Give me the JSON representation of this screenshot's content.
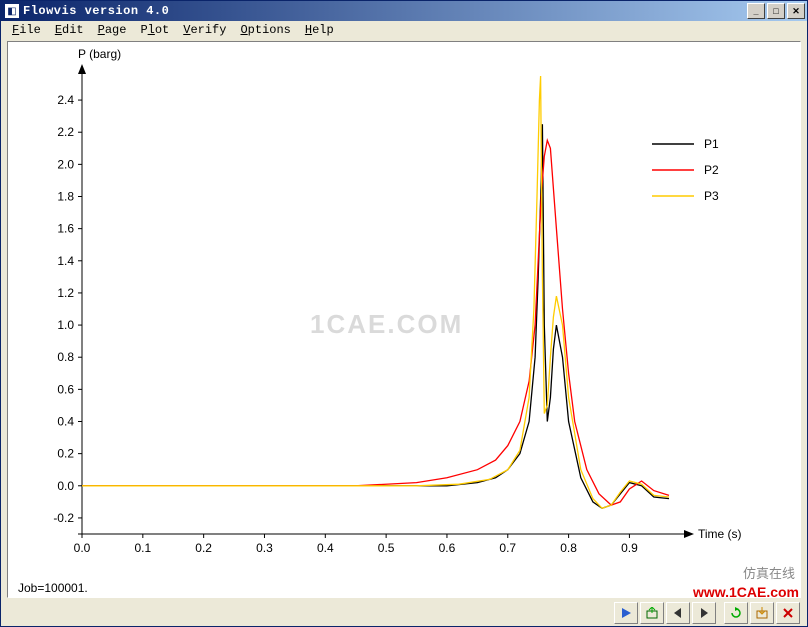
{
  "window": {
    "title": "Flowvis version 4.0"
  },
  "menu": {
    "file": "File",
    "edit": "Edit",
    "page": "Page",
    "plot": "Plot",
    "verify": "Verify",
    "options": "Options",
    "help": "Help"
  },
  "job_label": "Job=100001.",
  "legend": {
    "s1": "P1",
    "s2": "P2",
    "s3": "P3"
  },
  "colors": {
    "p1": "#000000",
    "p2": "#ff0000",
    "p3": "#ffcc00"
  },
  "watermarks": {
    "center": "1CAE.COM",
    "bottom_right": "www.1CAE.com",
    "bottom_right_gray": "仿真在线"
  },
  "chart_data": {
    "type": "line",
    "title": "",
    "xlabel": "Time (s)",
    "ylabel": "P (barg)",
    "xlim": [
      0.0,
      0.97
    ],
    "ylim": [
      -0.3,
      2.5
    ],
    "xticks": [
      0.0,
      0.1,
      0.2,
      0.3,
      0.4,
      0.5,
      0.6,
      0.7,
      0.8,
      0.9
    ],
    "yticks": [
      -0.2,
      0.0,
      0.2,
      0.4,
      0.6,
      0.8,
      1.0,
      1.2,
      1.4,
      1.6,
      1.8,
      2.0,
      2.2,
      2.4
    ],
    "series": [
      {
        "name": "P1",
        "color": "#000000",
        "x": [
          0.0,
          0.3,
          0.5,
          0.6,
          0.65,
          0.68,
          0.7,
          0.72,
          0.735,
          0.745,
          0.75,
          0.755,
          0.757,
          0.76,
          0.765,
          0.77,
          0.775,
          0.78,
          0.79,
          0.8,
          0.82,
          0.84,
          0.855,
          0.87,
          0.885,
          0.9,
          0.92,
          0.94,
          0.965
        ],
        "y": [
          0.0,
          0.0,
          0.0,
          0.0,
          0.02,
          0.05,
          0.1,
          0.2,
          0.4,
          0.8,
          1.3,
          1.9,
          2.25,
          1.0,
          0.4,
          0.55,
          0.85,
          1.0,
          0.8,
          0.4,
          0.05,
          -0.1,
          -0.14,
          -0.12,
          -0.05,
          0.02,
          0.0,
          -0.07,
          -0.08
        ]
      },
      {
        "name": "P2",
        "color": "#ff0000",
        "x": [
          0.0,
          0.3,
          0.45,
          0.55,
          0.6,
          0.65,
          0.68,
          0.7,
          0.72,
          0.735,
          0.745,
          0.75,
          0.755,
          0.76,
          0.765,
          0.77,
          0.78,
          0.79,
          0.8,
          0.81,
          0.83,
          0.85,
          0.87,
          0.885,
          0.9,
          0.92,
          0.94,
          0.965
        ],
        "y": [
          0.0,
          0.0,
          0.0,
          0.02,
          0.05,
          0.1,
          0.16,
          0.25,
          0.4,
          0.65,
          1.0,
          1.4,
          1.8,
          2.05,
          2.15,
          2.1,
          1.6,
          1.1,
          0.7,
          0.4,
          0.1,
          -0.05,
          -0.12,
          -0.1,
          -0.02,
          0.03,
          -0.03,
          -0.06
        ]
      },
      {
        "name": "P3",
        "color": "#ffcc00",
        "x": [
          0.0,
          0.4,
          0.55,
          0.62,
          0.67,
          0.7,
          0.72,
          0.735,
          0.743,
          0.748,
          0.752,
          0.754,
          0.757,
          0.76,
          0.765,
          0.77,
          0.775,
          0.78,
          0.79,
          0.8,
          0.82,
          0.84,
          0.855,
          0.87,
          0.885,
          0.9,
          0.92,
          0.94,
          0.965
        ],
        "y": [
          0.0,
          0.0,
          0.0,
          0.01,
          0.04,
          0.1,
          0.22,
          0.55,
          1.1,
          1.8,
          2.4,
          2.55,
          1.3,
          0.45,
          0.5,
          0.8,
          1.05,
          1.18,
          1.0,
          0.55,
          0.1,
          -0.08,
          -0.14,
          -0.12,
          -0.04,
          0.03,
          0.01,
          -0.06,
          -0.07
        ]
      }
    ]
  }
}
